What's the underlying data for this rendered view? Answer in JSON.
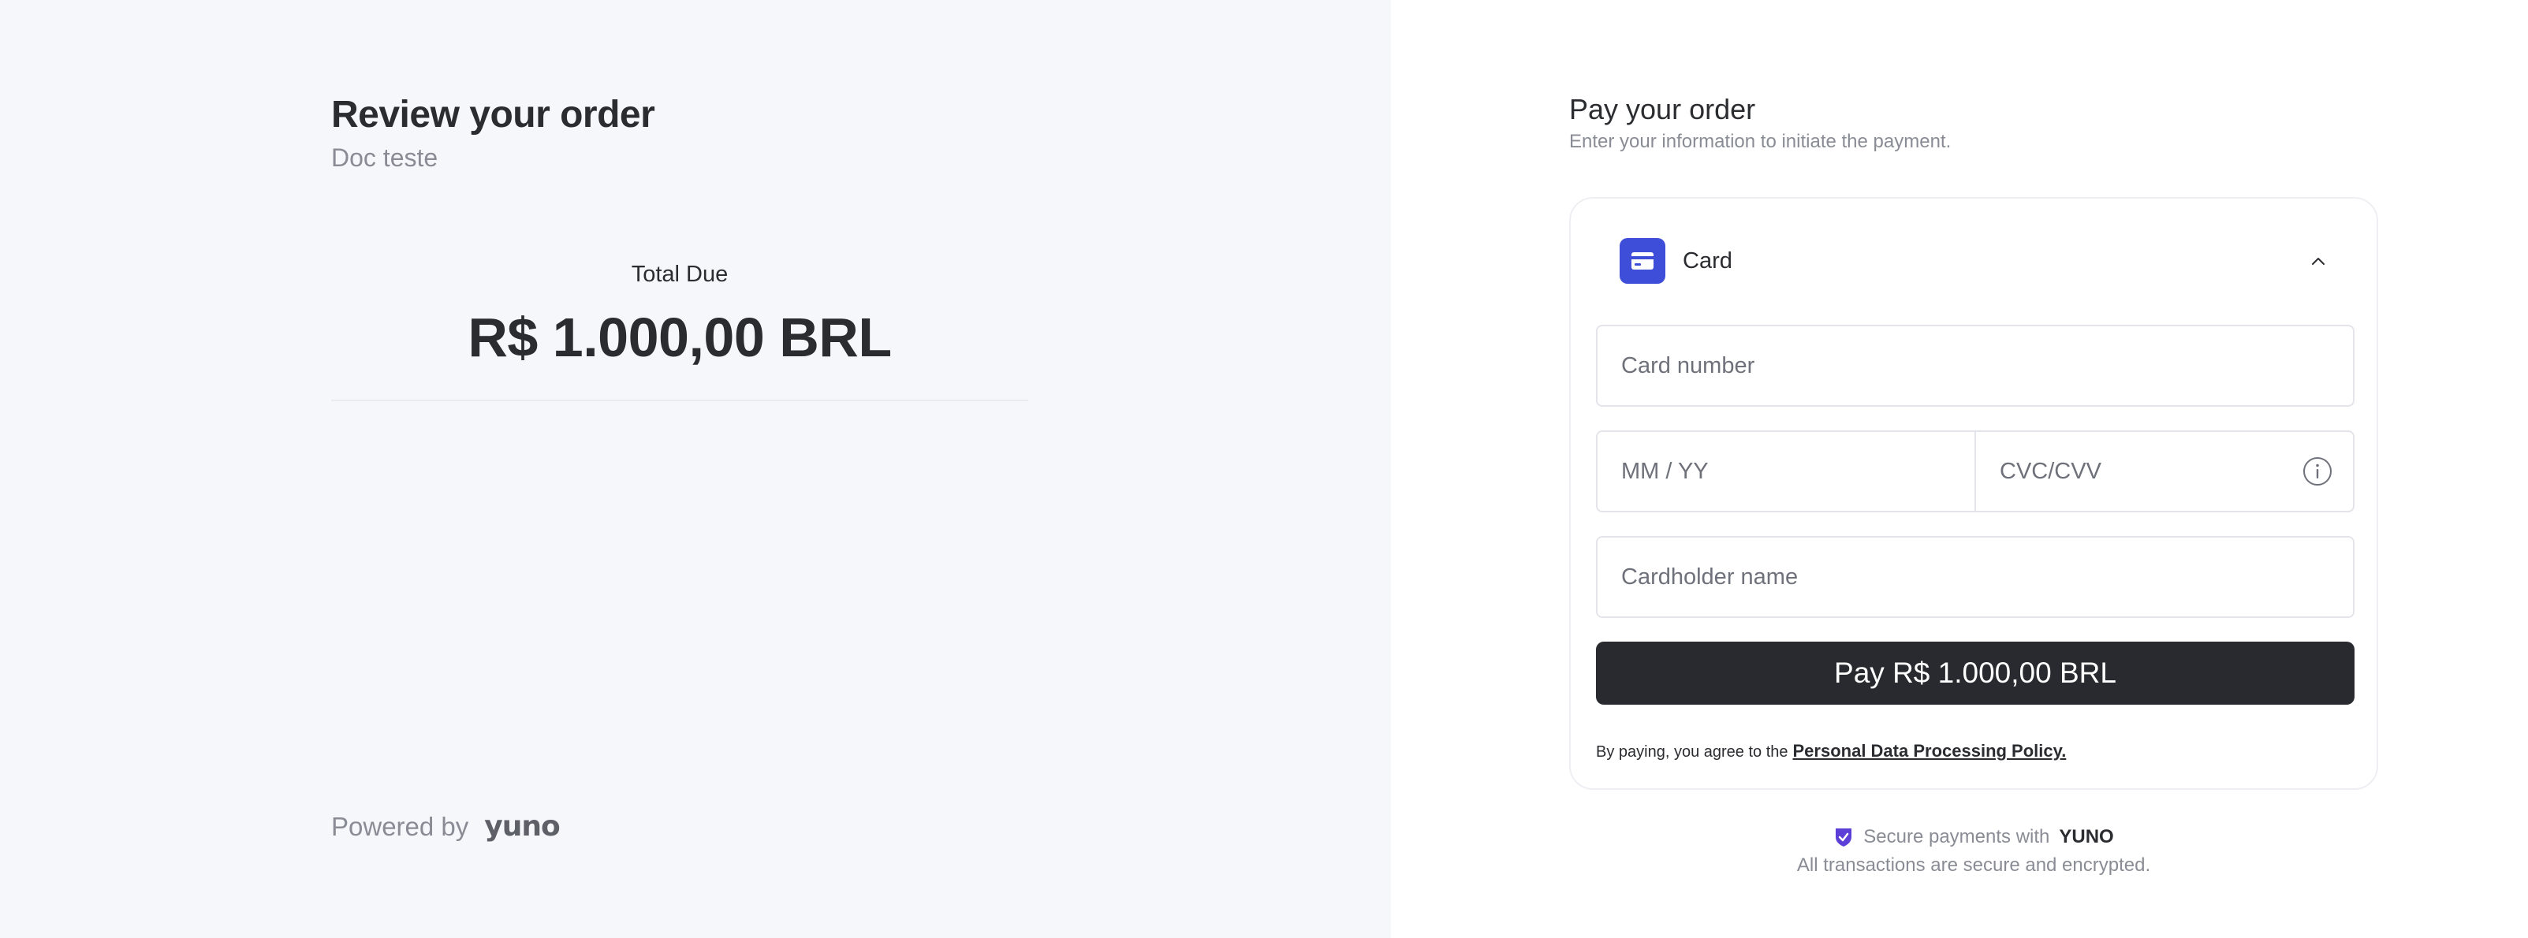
{
  "order": {
    "title": "Review your order",
    "merchant": "Doc teste",
    "total_label": "Total Due",
    "total_amount": "R$ 1.000,00 BRL"
  },
  "footer_left": {
    "powered_by": "Powered by",
    "brand": "yuno"
  },
  "payment": {
    "title": "Pay your order",
    "subtitle": "Enter your information to initiate the payment.",
    "method": {
      "label": "Card",
      "icon": "credit-card-icon",
      "expanded": true
    },
    "fields": {
      "card_number_placeholder": "Card number",
      "expiry_placeholder": "MM / YY",
      "cvc_placeholder": "CVC/CVV",
      "cardholder_placeholder": "Cardholder name"
    },
    "pay_button": "Pay R$ 1.000,00 BRL",
    "terms_prefix": "By paying, you agree to the",
    "terms_link": "Personal Data Processing Policy."
  },
  "secure": {
    "text": "Secure payments with",
    "brand": "YUNO",
    "note": "All transactions are secure and encrypted."
  },
  "colors": {
    "accent": "#3e4ed8",
    "button_bg": "#282a2f",
    "left_bg": "#f6f7fb",
    "shield": "#5b3fd6"
  }
}
